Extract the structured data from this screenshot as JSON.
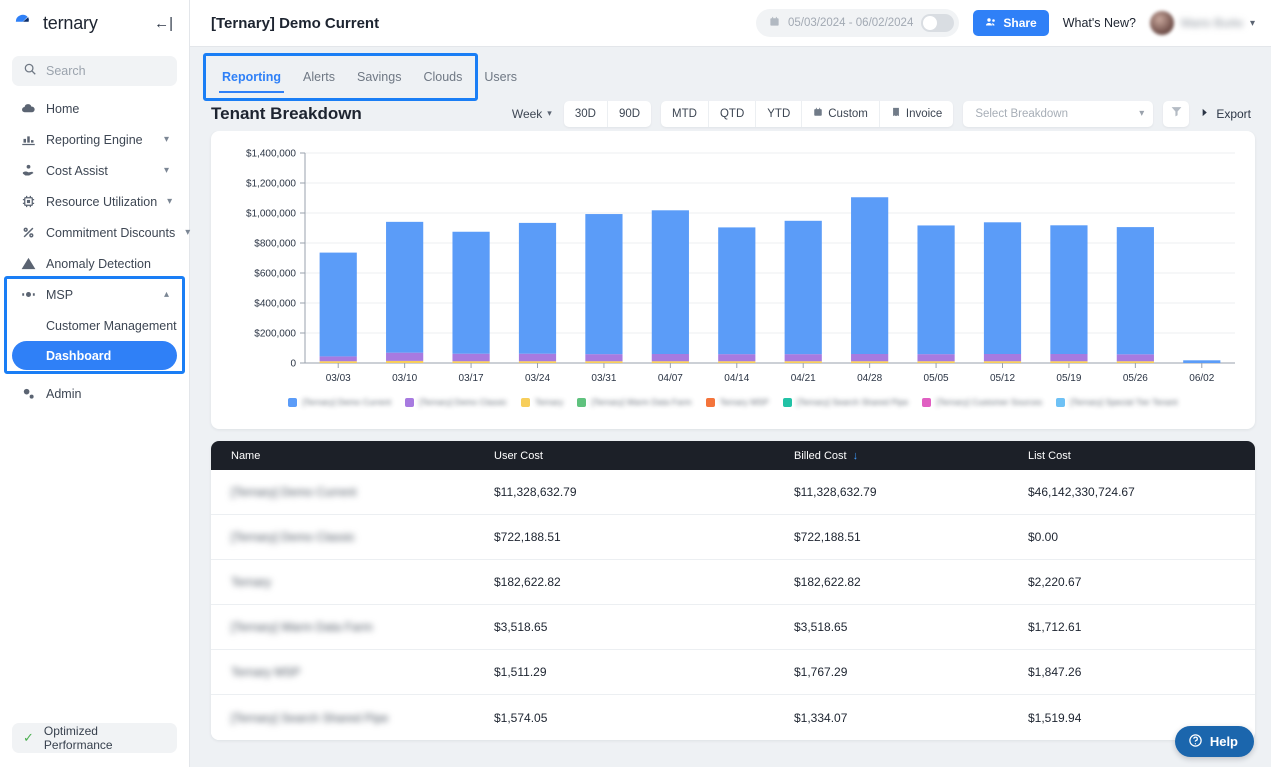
{
  "brand": {
    "name": "ternary",
    "collapse_icon": "collapse-panel-icon"
  },
  "sidebar": {
    "search": {
      "placeholder": "Search",
      "icon": "search-icon"
    },
    "items": [
      {
        "label": "Home",
        "icon": "cloud-icon",
        "expandable": false
      },
      {
        "label": "Reporting Engine",
        "icon": "bar-chart-icon",
        "expandable": true
      },
      {
        "label": "Cost Assist",
        "icon": "hand-coin-icon",
        "expandable": true
      },
      {
        "label": "Resource Utilization",
        "icon": "cpu-chip-icon",
        "expandable": true
      },
      {
        "label": "Commitment Discounts",
        "icon": "percent-icon",
        "expandable": true
      },
      {
        "label": "Anomaly Detection",
        "icon": "warning-triangle-icon",
        "expandable": false
      },
      {
        "label": "MSP",
        "icon": "msp-badge-icon",
        "expandable": true,
        "expanded": true
      }
    ],
    "msp_children": [
      {
        "label": "Customer Management",
        "active": false
      },
      {
        "label": "Dashboard",
        "active": true
      }
    ],
    "admin": {
      "label": "Admin",
      "icon": "gears-icon"
    },
    "footer": {
      "label": "Optimized Performance",
      "icon": "check-icon"
    }
  },
  "header": {
    "title": "[Ternary] Demo Current",
    "date_range": "05/03/2024 - 06/02/2024",
    "date_icon": "calendar-icon",
    "toggle_on": false,
    "share_label": "Share",
    "share_icon": "people-icon",
    "whats_new": "What's New?",
    "user_name": "Mario Burke",
    "user_chevron": "chevron-down-icon"
  },
  "tabs": [
    {
      "label": "Reporting",
      "active": true
    },
    {
      "label": "Alerts",
      "active": false
    },
    {
      "label": "Savings",
      "active": false
    },
    {
      "label": "Clouds",
      "active": false
    },
    {
      "label": "Users",
      "active": false
    }
  ],
  "section": {
    "title": "Tenant Breakdown",
    "granularity": "Week",
    "ranges": [
      {
        "label": "30D",
        "icon": null
      },
      {
        "label": "90D",
        "icon": null
      },
      {
        "label": "MTD",
        "icon": null
      },
      {
        "label": "QTD",
        "icon": null
      },
      {
        "label": "YTD",
        "icon": null
      },
      {
        "label": "Custom",
        "icon": "calendar-icon"
      },
      {
        "label": "Invoice",
        "icon": "receipt-icon"
      }
    ],
    "breakdown_placeholder": "Select Breakdown",
    "filter_icon": "funnel-icon",
    "export_label": "Export",
    "export_icon": "export-arrow-icon"
  },
  "chart_data": {
    "type": "bar",
    "stacked": true,
    "title": "Tenant Breakdown",
    "xlabel": "",
    "ylabel": "",
    "ylim": [
      0,
      1400000
    ],
    "yticks": [
      0,
      200000,
      400000,
      600000,
      800000,
      1000000,
      1200000,
      1400000
    ],
    "ytick_labels": [
      "0",
      "$200,000",
      "$400,000",
      "$600,000",
      "$800,000",
      "$1,000,000",
      "$1,200,000",
      "$1,400,000"
    ],
    "grid": true,
    "legend_position": "bottom",
    "categories": [
      "03/03",
      "03/10",
      "03/17",
      "03/24",
      "03/31",
      "04/07",
      "04/14",
      "04/21",
      "04/28",
      "05/05",
      "05/12",
      "05/19",
      "05/26",
      "06/02"
    ],
    "series": [
      {
        "name": "[Ternary] Demo Current",
        "color": "#5b9cf8",
        "values": [
          692000,
          872000,
          813000,
          872000,
          934000,
          958000,
          845000,
          889000,
          1045000,
          858000,
          878000,
          858000,
          848000,
          18000
        ]
      },
      {
        "name": "[Ternary] Demo Classic",
        "color": "#a77ae0",
        "values": [
          32000,
          55000,
          50000,
          50000,
          47000,
          48000,
          47000,
          47000,
          48000,
          47000,
          48000,
          48000,
          46000,
          0
        ]
      },
      {
        "name": "Ternary",
        "color": "#f7ce5b",
        "values": [
          12000,
          14000,
          12000,
          12000,
          12000,
          12000,
          12000,
          12000,
          12000,
          12000,
          12000,
          12000,
          12000,
          0
        ]
      },
      {
        "name": "[Ternary] Warm Data Farm",
        "color": "#5fc27e",
        "values": [
          0,
          0,
          0,
          0,
          0,
          0,
          0,
          0,
          0,
          0,
          0,
          0,
          0,
          0
        ]
      },
      {
        "name": "Ternary MSP",
        "color": "#f4743b",
        "values": [
          0,
          0,
          0,
          0,
          0,
          0,
          0,
          0,
          0,
          0,
          0,
          0,
          0,
          0
        ]
      },
      {
        "name": "[Ternary] Search Shared Pipe",
        "color": "#22c2a6",
        "values": [
          0,
          0,
          0,
          0,
          0,
          0,
          0,
          0,
          0,
          0,
          0,
          0,
          0,
          0
        ]
      },
      {
        "name": "[Ternary] Customer Sources",
        "color": "#e05fc2",
        "values": [
          0,
          0,
          0,
          0,
          0,
          0,
          0,
          0,
          0,
          0,
          0,
          0,
          0,
          0
        ]
      },
      {
        "name": "[Ternary] Special Tier Tenant",
        "color": "#6ec1f5",
        "values": [
          0,
          0,
          0,
          0,
          0,
          0,
          0,
          0,
          0,
          0,
          0,
          0,
          0,
          0
        ]
      }
    ]
  },
  "table": {
    "columns": [
      {
        "key": "name",
        "label": "Name",
        "sorted": false
      },
      {
        "key": "user_cost",
        "label": "User Cost",
        "sorted": false
      },
      {
        "key": "billed_cost",
        "label": "Billed Cost",
        "sorted": true,
        "sort_icon": "sort-desc-arrow-icon"
      },
      {
        "key": "list_cost",
        "label": "List Cost",
        "sorted": false
      }
    ],
    "rows": [
      {
        "name": "[Ternary] Demo Current",
        "user_cost": "$11,328,632.79",
        "billed_cost": "$11,328,632.79",
        "list_cost": "$46,142,330,724.67"
      },
      {
        "name": "[Ternary] Demo Classic",
        "user_cost": "$722,188.51",
        "billed_cost": "$722,188.51",
        "list_cost": "$0.00"
      },
      {
        "name": "Ternary",
        "user_cost": "$182,622.82",
        "billed_cost": "$182,622.82",
        "list_cost": "$2,220.67"
      },
      {
        "name": "[Ternary] Warm Data Farm",
        "user_cost": "$3,518.65",
        "billed_cost": "$3,518.65",
        "list_cost": "$1,712.61"
      },
      {
        "name": "Ternary MSP",
        "user_cost": "$1,511.29",
        "billed_cost": "$1,767.29",
        "list_cost": "$1,847.26"
      },
      {
        "name": "[Ternary] Search Shared Pipe",
        "user_cost": "$1,574.05",
        "billed_cost": "$1,334.07",
        "list_cost": "$1,519.94"
      }
    ]
  },
  "help": {
    "label": "Help",
    "icon": "question-circle-icon"
  },
  "colors": {
    "accent": "#2f80f7",
    "header_dark": "#1c2028",
    "annotation": "#1a7ef5"
  }
}
